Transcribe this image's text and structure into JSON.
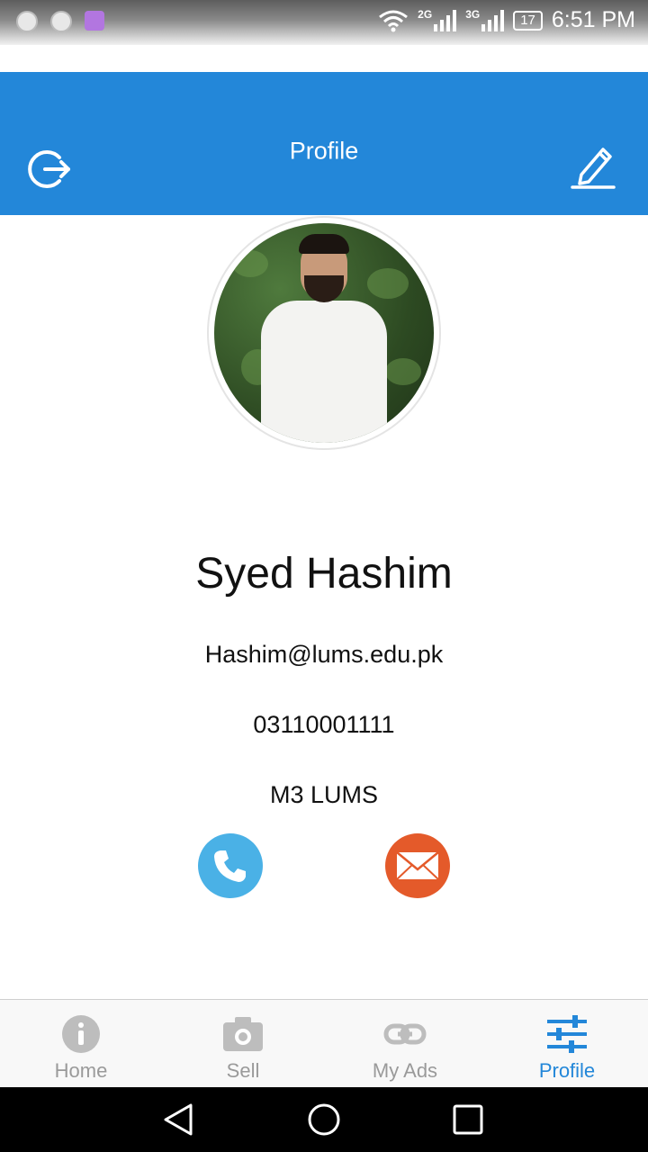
{
  "status_bar": {
    "net_a": "2G",
    "net_b": "3G",
    "battery": "17",
    "time": "6:51 PM"
  },
  "header": {
    "title": "Profile",
    "logout_icon": "logout-icon",
    "edit_icon": "pencil-icon"
  },
  "profile": {
    "name": "Syed Hashim",
    "email": "Hashim@lums.edu.pk",
    "phone": "03110001111",
    "location": "M3 LUMS"
  },
  "actions": {
    "call_icon": "phone-icon",
    "mail_icon": "envelope-icon"
  },
  "bottom_nav": {
    "items": [
      {
        "label": "Home",
        "icon": "info-icon"
      },
      {
        "label": "Sell",
        "icon": "camera-icon"
      },
      {
        "label": "My Ads",
        "icon": "link-icon"
      },
      {
        "label": "Profile",
        "icon": "sliders-icon"
      }
    ],
    "active": "Profile"
  },
  "colors": {
    "primary": "#2387d9",
    "call": "#4ab1e6",
    "mail": "#e45a2a",
    "inactive": "#9a9a9a"
  }
}
